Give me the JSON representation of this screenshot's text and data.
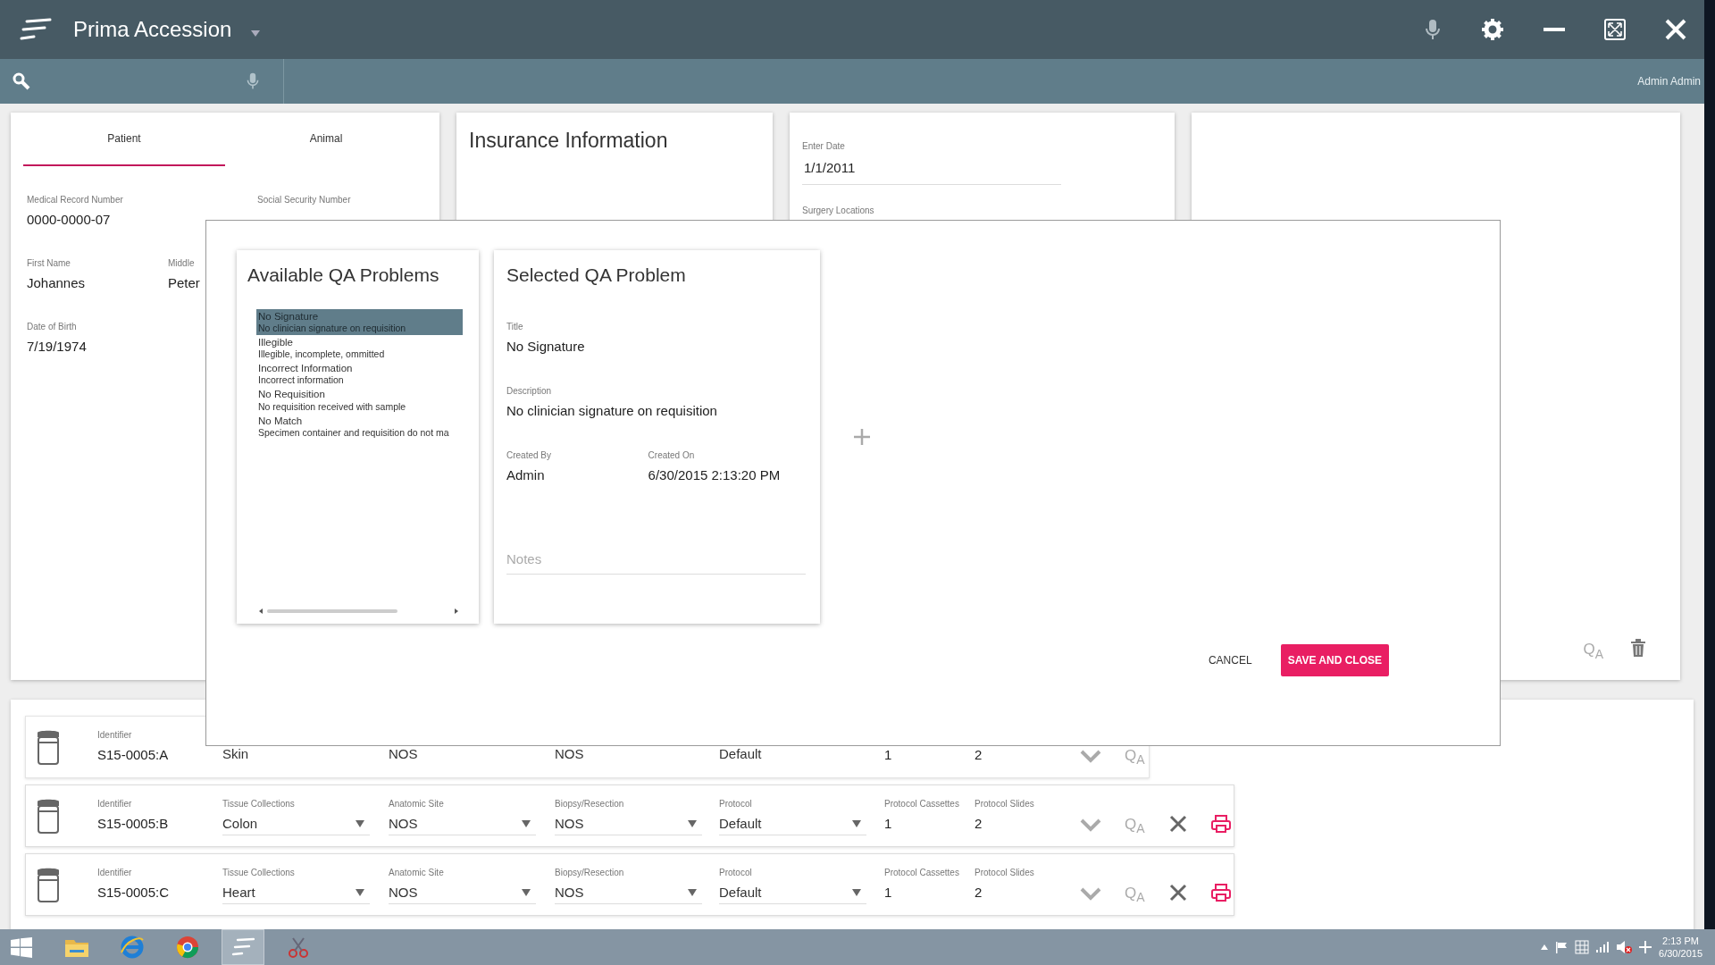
{
  "app": {
    "title": "Prima Accession",
    "user": "Admin Admin"
  },
  "patient_card": {
    "tabs": [
      {
        "label": "Patient",
        "selected": true
      },
      {
        "label": "Animal",
        "selected": false
      }
    ],
    "field_rows": [
      [
        {
          "label": "Medical Record Number",
          "value": "0000-0000-07"
        },
        {
          "label": "Social Security Number"
        }
      ],
      [
        {
          "label": "First Name",
          "value": "Johannes"
        },
        {
          "label": "Middle",
          "value": "Peter"
        }
      ],
      [
        {
          "label": "Date of Birth",
          "value": "7/19/1974"
        }
      ]
    ]
  },
  "insurance_card": {
    "title": "Insurance Information"
  },
  "date_card": {
    "fields": [
      {
        "label": "Enter Date",
        "value": "1/1/2011"
      },
      {
        "label": "Surgery Locations"
      }
    ]
  },
  "side_card": {
    "actions": [
      {
        "kind": "qa",
        "text": "Q$_{A}$"
      },
      {
        "kind": "delete"
      }
    ]
  },
  "qa_dialog": {
    "available": {
      "title": "Available QA Problems",
      "items": [
        {
          "title": "No Signature",
          "description": "No clinician signature on requisition",
          "selected": true
        },
        {
          "title": "Illegible",
          "description": "Illegible, incomplete, ommitted",
          "selected": false
        },
        {
          "title": "Incorrect Information",
          "description": "Incorrect information",
          "selected": false
        },
        {
          "title": "No Requisition",
          "description": "No requisition received with sample",
          "selected": false
        },
        {
          "title": "No Match",
          "description": "Specimen container and requisition do not ma",
          "selected": false
        }
      ]
    },
    "selected_problem": {
      "heading": "Selected QA Problem",
      "fields": [
        {
          "label": "Title",
          "value": "No Signature"
        },
        {
          "label": "Description",
          "value": "No clinician signature on requisition"
        }
      ],
      "meta": [
        {
          "label": "Created By",
          "value": "Admin"
        },
        {
          "label": "Created On",
          "value": "6/30/2015 2:13:20 PM"
        }
      ],
      "notes_placeholder": "Notes"
    },
    "buttons": [
      {
        "kind": "text",
        "label": "CANCEL"
      },
      {
        "kind": "primary",
        "label": "SAVE AND CLOSE"
      }
    ]
  },
  "specimens": [
    {
      "identifier_label": "Identifier",
      "identifier": "S15-0005:A",
      "editable": false,
      "cells": [
        {
          "kind": "select",
          "value": "Skin"
        },
        {
          "kind": "select",
          "value": "NOS"
        },
        {
          "kind": "select",
          "value": "NOS"
        },
        {
          "kind": "select",
          "value": "Default"
        },
        {
          "kind": "text",
          "value": "1"
        },
        {
          "kind": "text",
          "value": "2"
        }
      ],
      "actions": [
        {
          "kind": "expand"
        },
        {
          "kind": "qa",
          "text": "Q$_{A}$"
        }
      ]
    },
    {
      "identifier_label": "Identifier",
      "identifier": "S15-0005:B",
      "editable": true,
      "cells": [
        {
          "kind": "select",
          "label": "Tissue Collections",
          "value": "Colon"
        },
        {
          "kind": "select",
          "label": "Anatomic Site",
          "value": "NOS"
        },
        {
          "kind": "select",
          "label": "Biopsy/Resection",
          "value": "NOS"
        },
        {
          "kind": "select",
          "label": "Protocol",
          "value": "Default"
        },
        {
          "kind": "text",
          "label": "Protocol Cassettes",
          "value": "1"
        },
        {
          "kind": "text",
          "label": "Protocol Slides",
          "value": "2"
        }
      ],
      "actions": [
        {
          "kind": "expand"
        },
        {
          "kind": "qa",
          "text": "Q$_{A}$"
        },
        {
          "kind": "remove"
        },
        {
          "kind": "print"
        }
      ]
    },
    {
      "identifier_label": "Identifier",
      "identifier": "S15-0005:C",
      "editable": true,
      "cells": [
        {
          "kind": "select",
          "label": "Tissue Collections",
          "value": "Heart"
        },
        {
          "kind": "select",
          "label": "Anatomic Site",
          "value": "NOS"
        },
        {
          "kind": "select",
          "label": "Biopsy/Resection",
          "value": "NOS"
        },
        {
          "kind": "select",
          "label": "Protocol",
          "value": "Default"
        },
        {
          "kind": "text",
          "label": "Protocol Cassettes",
          "value": "1"
        },
        {
          "kind": "text",
          "label": "Protocol Slides",
          "value": "2"
        }
      ],
      "actions": [
        {
          "kind": "expand"
        },
        {
          "kind": "qa",
          "text": "Q$_{A}$"
        },
        {
          "kind": "remove"
        },
        {
          "kind": "print"
        }
      ]
    }
  ],
  "taskbar": {
    "time": "2:13 PM",
    "date": "6/30/2015"
  }
}
